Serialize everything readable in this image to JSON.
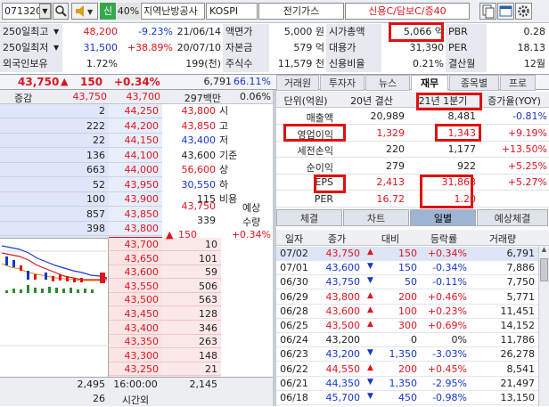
{
  "toolbar": {
    "code": "071320",
    "stock_name": "지역난방공사",
    "market": "KOSPI",
    "sector": "전기가스",
    "credit": "신용C/담보C/증40",
    "badge_sin": "신",
    "badge_40": "40%"
  },
  "info": {
    "r1": {
      "a_label": "250일최고",
      "a_val": "48,200",
      "a_pct": "-9.23%",
      "a_date": "21/06/14",
      "b_label": "액면가",
      "b_val": "5,000 원",
      "c_label": "시가총액",
      "c_val": "5,066 억",
      "d_label": "PBR",
      "d_val": "0.28"
    },
    "r2": {
      "a_label": "250일최저",
      "a_val": "31,500",
      "a_pct": "+38.89%",
      "a_date": "20/07/10",
      "b_label": "자본금",
      "b_val": "579 억",
      "c_label": "대용가",
      "c_val": "31,390",
      "d_label": "PER",
      "d_val": "18.13"
    },
    "r3": {
      "a_label": "외국인보유",
      "a_pct": "1.72%",
      "a_vol": "199(천)",
      "b_label": "주식수",
      "b_val": "11,579 천",
      "c_label": "신용비율",
      "c_val": "0.21%",
      "d_label": "결산월",
      "d_val": "12월"
    }
  },
  "quote": {
    "price": "43,750",
    "arrow": "▲",
    "change": "150",
    "pct": "+0.34%",
    "volume": "6,791",
    "vol_pct": "66.11%",
    "amount": "297백만",
    "amount_pct": "0.06%",
    "hdr_label": "증감",
    "hdr_prev": "43,750",
    "hdr_cur": "43,700"
  },
  "orderbook": {
    "ask": [
      [
        "2",
        "44,250"
      ],
      [
        "222",
        "44,200"
      ],
      [
        "22",
        "44,150"
      ],
      [
        "136",
        "44,100"
      ],
      [
        "663",
        "44,000"
      ],
      [
        "52",
        "43,950"
      ],
      [
        "100",
        "43,900"
      ],
      [
        "857",
        "43,850"
      ],
      [
        "398",
        "43,800"
      ],
      [
        "43",
        "43,750"
      ]
    ],
    "bid": [
      [
        "43,700",
        "10"
      ],
      [
        "43,650",
        "101"
      ],
      [
        "43,600",
        "59"
      ],
      [
        "43,550",
        "506"
      ],
      [
        "43,500",
        "563"
      ],
      [
        "43,450",
        "128"
      ],
      [
        "43,400",
        "346"
      ],
      [
        "43,350",
        "263"
      ],
      [
        "43,300",
        "148"
      ],
      [
        "43,250",
        "21"
      ]
    ],
    "side": [
      [
        "43,800",
        "시"
      ],
      [
        "43,850",
        "고"
      ],
      [
        "43,400",
        "저"
      ],
      [
        "43,600",
        "기준"
      ],
      [
        "56,600",
        "상"
      ],
      [
        "30,550",
        "하"
      ],
      [
        "115",
        "비용"
      ]
    ],
    "expect": {
      "price": "43,750",
      "label": "예상",
      "qty": "339",
      "qty_label": "수량",
      "chg": "150",
      "chg_pct": "+0.34%"
    },
    "footer": {
      "ask_total": "2,495",
      "time": "16:00:00",
      "bid_total": "2,145",
      "ask_after": "26",
      "after_label": "시간외"
    }
  },
  "fin_tabs": [
    "거래원",
    "투자자",
    "뉴스",
    "재무",
    "종목별",
    "프로"
  ],
  "fin": {
    "headers": [
      "단위(억원)",
      "20년 결산",
      "21년 1분기",
      "증가율(YOY)"
    ],
    "rows": [
      [
        "매출액",
        "20,989",
        "8,481",
        "-0.81%"
      ],
      [
        "영업이익",
        "1,329",
        "1,343",
        "+9.19%"
      ],
      [
        "세전손익",
        "220",
        "1,177",
        "+13.50%"
      ],
      [
        "순이익",
        "279",
        "922",
        "+5.25%"
      ],
      [
        "EPS",
        "2,413",
        "31,868",
        "+5.27%"
      ],
      [
        "PER",
        "16.72",
        "1.20",
        ""
      ]
    ]
  },
  "daily_tabs": [
    "체결",
    "차트",
    "일별",
    "예상체결"
  ],
  "daily": {
    "headers": [
      "일자",
      "종가",
      "대비",
      "등락률",
      "거래량"
    ],
    "rows": [
      [
        "07/02",
        "43,750",
        "▲",
        "150",
        "+0.34%",
        "6,791"
      ],
      [
        "07/01",
        "43,600",
        "▼",
        "150",
        "-0.34%",
        "7,886"
      ],
      [
        "06/30",
        "43,750",
        "▼",
        "50",
        "-0.11%",
        "7,750"
      ],
      [
        "06/29",
        "43,800",
        "▲",
        "200",
        "+0.46%",
        "5,771"
      ],
      [
        "06/28",
        "43,600",
        "▲",
        "100",
        "+0.23%",
        "11,451"
      ],
      [
        "06/25",
        "43,500",
        "▲",
        "300",
        "+0.69%",
        "14,152"
      ],
      [
        "06/24",
        "43,200",
        "",
        "0",
        "0%",
        "11,786"
      ],
      [
        "06/23",
        "43,200",
        "▼",
        "1,350",
        "-3.03%",
        "26,278"
      ],
      [
        "06/22",
        "44,550",
        "▲",
        "200",
        "+0.45%",
        "8,541"
      ],
      [
        "06/21",
        "44,350",
        "▼",
        "1,350",
        "-2.95%",
        "21,497"
      ],
      [
        "06/18",
        "45,700",
        "▼",
        "450",
        "-0.98%",
        "13,150"
      ]
    ]
  },
  "colors": {
    "up": "#e0141e",
    "down": "#1435d2",
    "highlight": "#e01010"
  }
}
